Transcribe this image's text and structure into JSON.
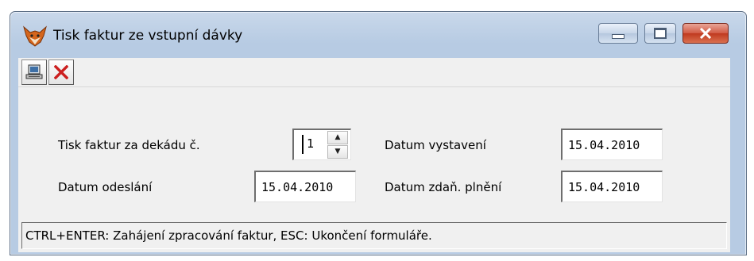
{
  "window": {
    "title": "Tisk faktur ze vstupní dávky",
    "icon": "fox-app-icon"
  },
  "toolbar": {
    "print_icon": "computer-print-icon",
    "close_icon": "close-x-icon",
    "close_color": "#cc1f1f"
  },
  "form": {
    "decade_label": "Tisk faktur za dekádu č.",
    "decade_value": "1",
    "issue_date_label": "Datum vystavení",
    "issue_date_value": "15.04.2010",
    "send_date_label": "Datum odeslání",
    "send_date_value": "15.04.2010",
    "tax_date_label": "Datum zdaň. plnění",
    "tax_date_value": "15.04.2010"
  },
  "status": {
    "text": "CTRL+ENTER: Zahájení zpracování faktur, ESC: Ukončení formuláře."
  }
}
